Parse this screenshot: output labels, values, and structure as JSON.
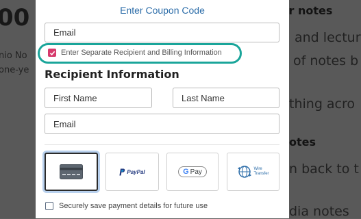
{
  "background": {
    "fragments": [
      "00",
      "ir notes",
      "and lectur",
      "nio No",
      "of notes b",
      "one-ye",
      "thing acro",
      "otes",
      "n back to t",
      "dia notes"
    ]
  },
  "modal": {
    "coupon_link": "Enter Coupon Code",
    "email_placeholder": "Email",
    "separate_info_label": "Enter Separate Recipient and Billing Information",
    "separate_info_checked": true,
    "recipient_heading": "Recipient Information",
    "first_name_placeholder": "First Name",
    "last_name_placeholder": "Last Name",
    "recipient_email_placeholder": "Email",
    "payment_methods": [
      {
        "name": "Card",
        "icon": "credit-card-icon",
        "selected": true
      },
      {
        "name": "PayPal",
        "icon": "paypal-logo",
        "selected": false
      },
      {
        "name": "G Pay",
        "icon": "google-pay-logo",
        "selected": false
      },
      {
        "name": "Wire Transfer",
        "icon": "wire-transfer-icon",
        "selected": false
      }
    ],
    "paypal_text": "PayPal",
    "gpay_text": "Pay",
    "gpay_g": "G",
    "wire_text_line1": "Wire",
    "wire_text_line2": "Transfer",
    "save_payment_label": "Securely save payment details for future use",
    "save_payment_checked": false
  },
  "colors": {
    "accent_link": "#2b6ca8",
    "checkbox_checked": "#d63a6c",
    "highlight_ring": "#1aa59a",
    "paypal_dark": "#253b80",
    "paypal_light": "#179bd7"
  }
}
